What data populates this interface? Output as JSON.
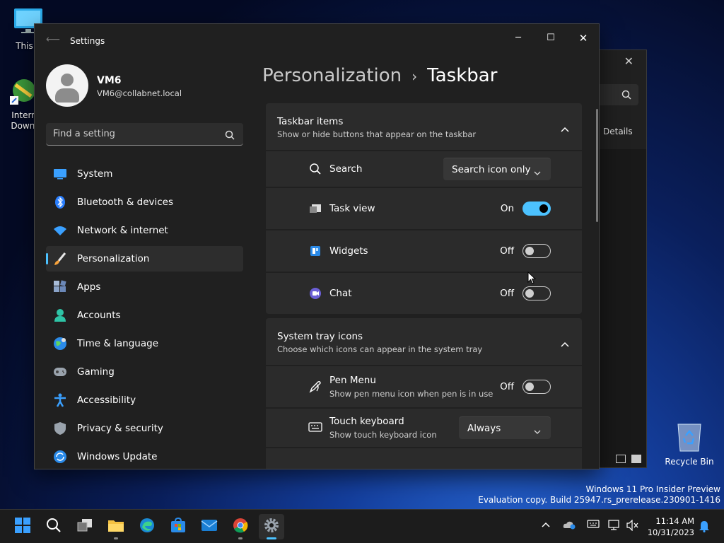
{
  "desktop": {
    "icons": [
      {
        "label": "This P",
        "icon": "monitor-icon"
      },
      {
        "label": "Intern Downl",
        "icon": "download-manager-icon"
      },
      {
        "label": "Recycle Bin",
        "icon": "recycle-bin-icon"
      }
    ],
    "watermark_line1": "Windows 11 Pro Insider Preview",
    "watermark_line2": "Evaluation copy. Build 25947.rs_prerelease.230901-1416"
  },
  "background_window": {
    "details_label": "Details"
  },
  "settings": {
    "title": "Settings",
    "user": {
      "name": "VM6",
      "email": "VM6@collabnet.local"
    },
    "search": {
      "placeholder": "Find a setting",
      "value": ""
    },
    "nav": [
      {
        "label": "System",
        "icon": "system-icon",
        "active": false
      },
      {
        "label": "Bluetooth & devices",
        "icon": "bluetooth-icon",
        "active": false
      },
      {
        "label": "Network & internet",
        "icon": "wifi-icon",
        "active": false
      },
      {
        "label": "Personalization",
        "icon": "brush-icon",
        "active": true
      },
      {
        "label": "Apps",
        "icon": "apps-icon",
        "active": false
      },
      {
        "label": "Accounts",
        "icon": "accounts-icon",
        "active": false
      },
      {
        "label": "Time & language",
        "icon": "globe-icon",
        "active": false
      },
      {
        "label": "Gaming",
        "icon": "gamepad-icon",
        "active": false
      },
      {
        "label": "Accessibility",
        "icon": "accessibility-icon",
        "active": false
      },
      {
        "label": "Privacy & security",
        "icon": "shield-icon",
        "active": false
      },
      {
        "label": "Windows Update",
        "icon": "update-icon",
        "active": false
      }
    ],
    "breadcrumb": {
      "parent": "Personalization",
      "separator": "›",
      "current": "Taskbar"
    },
    "taskbar_items": {
      "title": "Taskbar items",
      "subtitle": "Show or hide buttons that appear on the taskbar",
      "search": {
        "label": "Search",
        "value": "Search icon only"
      },
      "task_view": {
        "label": "Task view",
        "state": "On",
        "on": true
      },
      "widgets": {
        "label": "Widgets",
        "state": "Off",
        "on": false
      },
      "chat": {
        "label": "Chat",
        "state": "Off",
        "on": false
      }
    },
    "system_tray": {
      "title": "System tray icons",
      "subtitle": "Choose which icons can appear in the system tray",
      "pen_menu": {
        "label": "Pen Menu",
        "desc": "Show pen menu icon when pen is in use",
        "state": "Off",
        "on": false
      },
      "touch_keyboard": {
        "label": "Touch keyboard",
        "desc": "Show touch keyboard icon",
        "value": "Always"
      }
    }
  },
  "taskbar": {
    "apps": [
      "start-icon",
      "search-icon",
      "task-view-icon",
      "file-explorer-icon",
      "edge-icon",
      "store-icon",
      "mail-icon",
      "chrome-icon",
      "settings-icon"
    ],
    "time": "11:14 AM",
    "date": "10/31/2023"
  },
  "colors": {
    "accent": "#4cc2ff",
    "window_bg": "#202020",
    "card_bg": "#2b2b2b"
  }
}
